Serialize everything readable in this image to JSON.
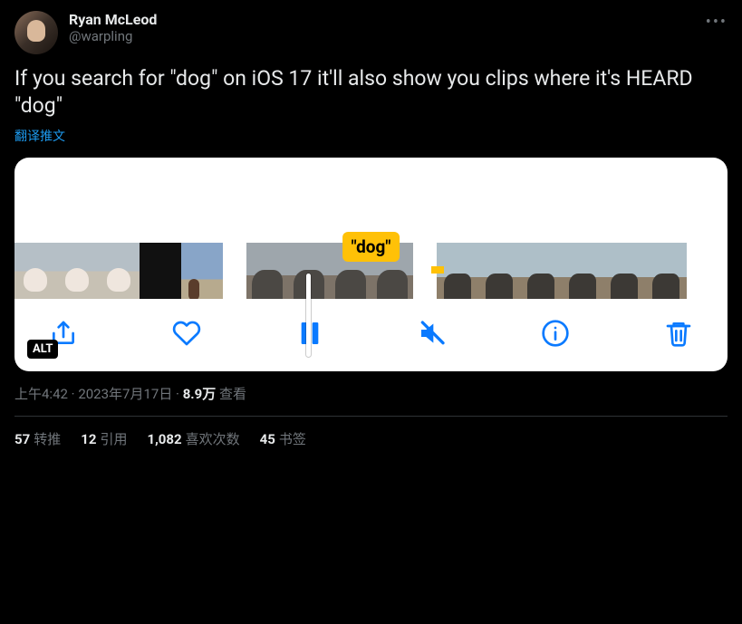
{
  "author": {
    "display_name": "Ryan McLeod",
    "handle": "@warpling"
  },
  "body": "If you search for \"dog\" on iOS 17 it'll also show you clips where it's HEARD \"dog\"",
  "translate_label": "翻译推文",
  "media": {
    "search_term": "\"dog\"",
    "alt_badge": "ALT"
  },
  "meta": {
    "time": "上午4:42",
    "date": "2023年7月17日",
    "views_num": "8.9万",
    "views_label": "查看"
  },
  "stats": {
    "retweets": {
      "num": "57",
      "label": "转推"
    },
    "quotes": {
      "num": "12",
      "label": "引用"
    },
    "likes": {
      "num": "1,082",
      "label": "喜欢次数"
    },
    "bookmarks": {
      "num": "45",
      "label": "书签"
    }
  }
}
